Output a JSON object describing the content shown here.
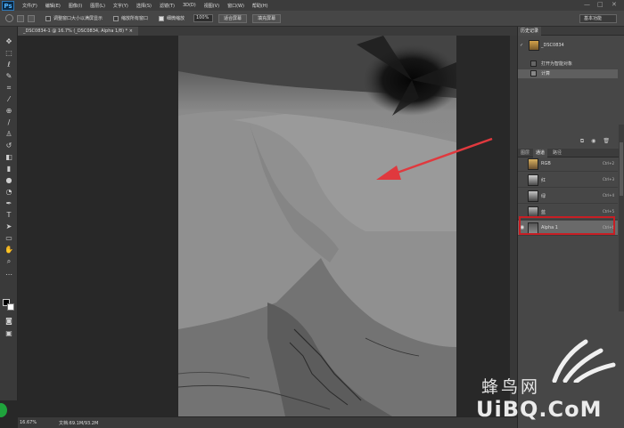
{
  "menubar": {
    "logo": "Ps",
    "items": [
      "文件(F)",
      "编辑(E)",
      "图像(I)",
      "图层(L)",
      "文字(Y)",
      "选择(S)",
      "滤镜(T)",
      "3D(D)",
      "视图(V)",
      "窗口(W)",
      "帮助(H)"
    ],
    "window_controls": [
      "—",
      "□",
      "✕"
    ]
  },
  "options": {
    "resize_windows_label": "调整窗口大小以满屏显示",
    "resize_windows_checked": false,
    "zoom_all_label": "缩放所有窗口",
    "zoom_all_checked": false,
    "scrubby_zoom_label": "细微缩放",
    "scrubby_zoom_checked": true,
    "zoom_value": "100%",
    "fit_screen_label": "适合屏幕",
    "fill_screen_label": "填充屏幕",
    "workspace": "基本功能"
  },
  "document": {
    "tab_title": "_DSC0834-1 @ 16.7% (_DSC0834, Alpha 1/8) *",
    "close": "×"
  },
  "status": {
    "zoom": "16.67%",
    "doc_size": "文档:69.1M/93.2M"
  },
  "history": {
    "tab": "历史记录",
    "snapshot": "_DSC0834",
    "items": [
      {
        "label": "打开为智能对象",
        "selected": false
      },
      {
        "label": "计算",
        "selected": true
      }
    ]
  },
  "channels": {
    "tabs": [
      "图层",
      "通道",
      "路径"
    ],
    "active_tab": "通道",
    "rows": [
      {
        "name": "RGB",
        "shortcut": "Ctrl+2",
        "visible": false
      },
      {
        "name": "红",
        "shortcut": "Ctrl+3",
        "visible": false
      },
      {
        "name": "绿",
        "shortcut": "Ctrl+4",
        "visible": false
      },
      {
        "name": "蓝",
        "shortcut": "Ctrl+5",
        "visible": false
      },
      {
        "name": "Alpha 1",
        "shortcut": "Ctrl+6",
        "visible": true,
        "selected": true
      }
    ]
  },
  "watermark": {
    "cn": "蜂鸟网",
    "en": "UiBQ.CoM"
  },
  "colors": {
    "highlight": "#c81e24",
    "arrow": "#e0393e"
  }
}
